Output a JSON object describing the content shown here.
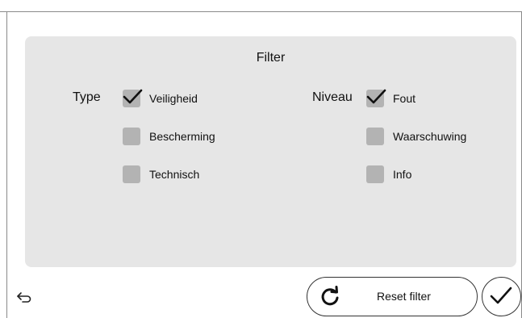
{
  "filter": {
    "title": "Filter",
    "type_group": {
      "label": "Type",
      "options": [
        {
          "label": "Veiligheid",
          "checked": true
        },
        {
          "label": "Bescherming",
          "checked": false
        },
        {
          "label": "Technisch",
          "checked": false
        }
      ]
    },
    "level_group": {
      "label": "Niveau",
      "options": [
        {
          "label": "Fout",
          "checked": true
        },
        {
          "label": "Waarschuwing",
          "checked": false
        },
        {
          "label": "Info",
          "checked": false
        }
      ]
    }
  },
  "footer": {
    "back_icon": "back-arrow-icon",
    "reset_icon": "refresh-icon",
    "reset_label": "Reset filter",
    "confirm_icon": "checkmark-icon"
  },
  "colors": {
    "panel_bg": "#e6e6e6",
    "checkbox_bg": "#b3b3b3",
    "text": "#111111"
  }
}
